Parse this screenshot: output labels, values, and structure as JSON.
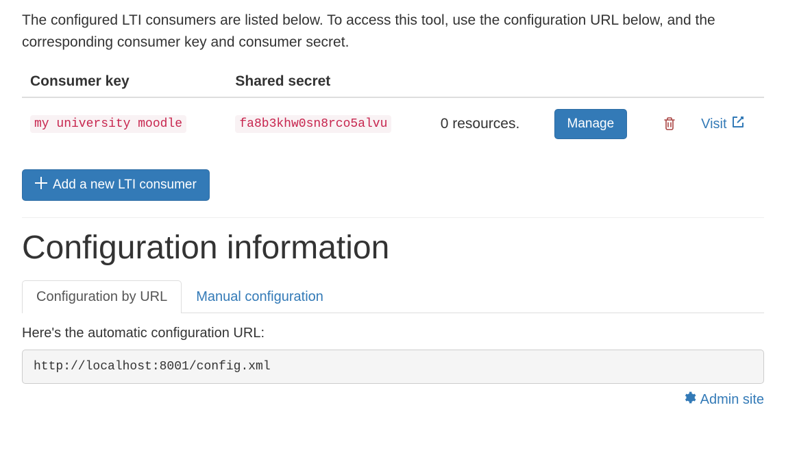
{
  "intro": "The configured LTI consumers are listed below. To access this tool, use the configuration URL below, and the corresponding consumer key and consumer secret.",
  "table": {
    "headers": {
      "key": "Consumer key",
      "secret": "Shared secret"
    },
    "rows": [
      {
        "key": "my university moodle",
        "secret": "fa8b3khw0sn8rco5alvu",
        "resources": "0 resources.",
        "manage": "Manage",
        "visit": "Visit"
      }
    ]
  },
  "add_button": "Add a new LTI consumer",
  "section_title": "Configuration information",
  "tabs": {
    "url": "Configuration by URL",
    "manual": "Manual configuration"
  },
  "config_desc": "Here's the automatic configuration URL:",
  "config_url": "http://localhost:8001/config.xml",
  "admin_link": "Admin site"
}
